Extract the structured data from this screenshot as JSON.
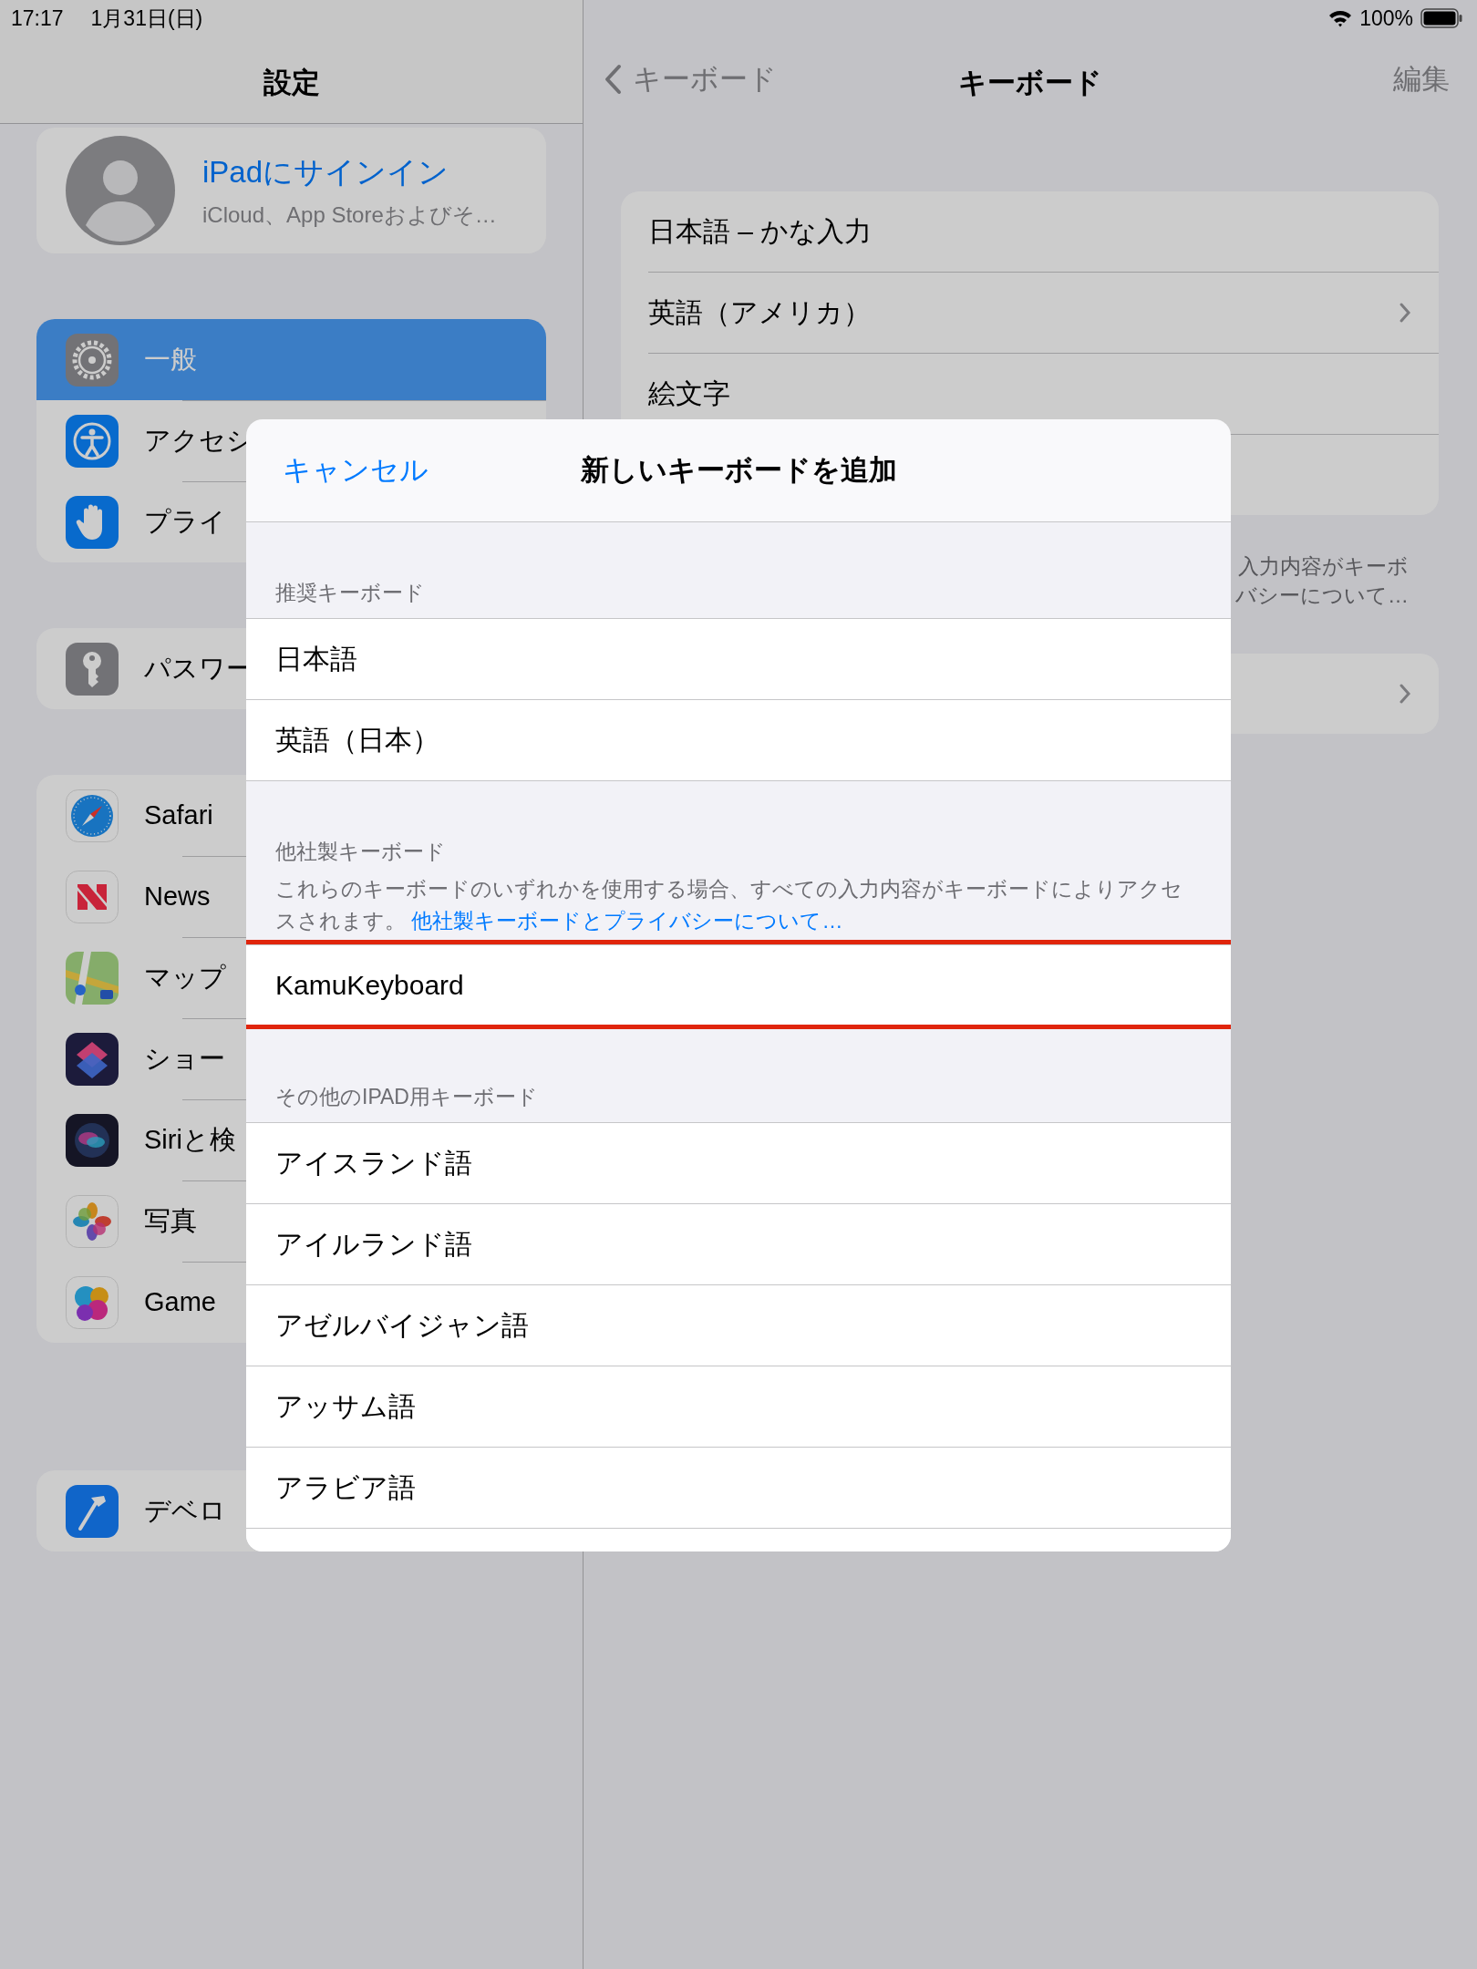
{
  "status_bar": {
    "time": "17:17",
    "date": "1月31日(日)",
    "battery": "100%"
  },
  "sidebar": {
    "title": "設定",
    "profile": {
      "name": "iPadにサインイン",
      "subtitle": "iCloud、App Storeおよびそ…"
    },
    "groups": [
      {
        "items": [
          {
            "label": "一般",
            "selected": true
          },
          {
            "label": "アクセシ",
            "selected": false
          },
          {
            "label": "プライ",
            "selected": false
          }
        ]
      },
      {
        "items": [
          {
            "label": "パスワー",
            "selected": false
          }
        ]
      },
      {
        "items": [
          {
            "label": "Safari",
            "selected": false
          },
          {
            "label": "News",
            "selected": false
          },
          {
            "label": "マップ",
            "selected": false
          },
          {
            "label": "ショー",
            "selected": false
          },
          {
            "label": "Siriと検",
            "selected": false
          },
          {
            "label": "写真",
            "selected": false
          },
          {
            "label": "Game",
            "selected": false
          }
        ]
      },
      {
        "items": [
          {
            "label": "デベロ",
            "selected": false
          }
        ]
      }
    ]
  },
  "detail": {
    "back": "キーボード",
    "title": "キーボード",
    "action": "編集",
    "keyboards": [
      {
        "label": "日本語 – かな入力",
        "chevron": false
      },
      {
        "label": "英語（アメリカ）",
        "chevron": true
      },
      {
        "label": "絵文字",
        "chevron": false
      }
    ],
    "footer_lines": [
      "入力内容がキーボ",
      "バシーについて…"
    ],
    "extra_row": {
      "chevron": true
    }
  },
  "modal": {
    "cancel": "キャンセル",
    "title": "新しいキーボードを追加",
    "sections": [
      {
        "header": "推奨キーボード",
        "items": [
          {
            "label": "日本語",
            "highlighted": false
          },
          {
            "label": "英語（日本）",
            "highlighted": false
          }
        ]
      },
      {
        "header": "他社製キーボード",
        "note": "これらのキーボードのいずれかを使用する場合、すべての入力内容がキーボードによりアクセスされます。",
        "link": "他社製キーボードとプライバシーについて…",
        "items": [
          {
            "label": "KamuKeyboard",
            "highlighted": true
          }
        ]
      },
      {
        "header": "その他のIPAD用キーボード",
        "items": [
          {
            "label": "アイスランド語",
            "highlighted": false
          },
          {
            "label": "アイルランド語",
            "highlighted": false
          },
          {
            "label": "アゼルバイジャン語",
            "highlighted": false
          },
          {
            "label": "アッサム語",
            "highlighted": false
          },
          {
            "label": "アラビア語",
            "highlighted": false
          }
        ]
      }
    ]
  }
}
